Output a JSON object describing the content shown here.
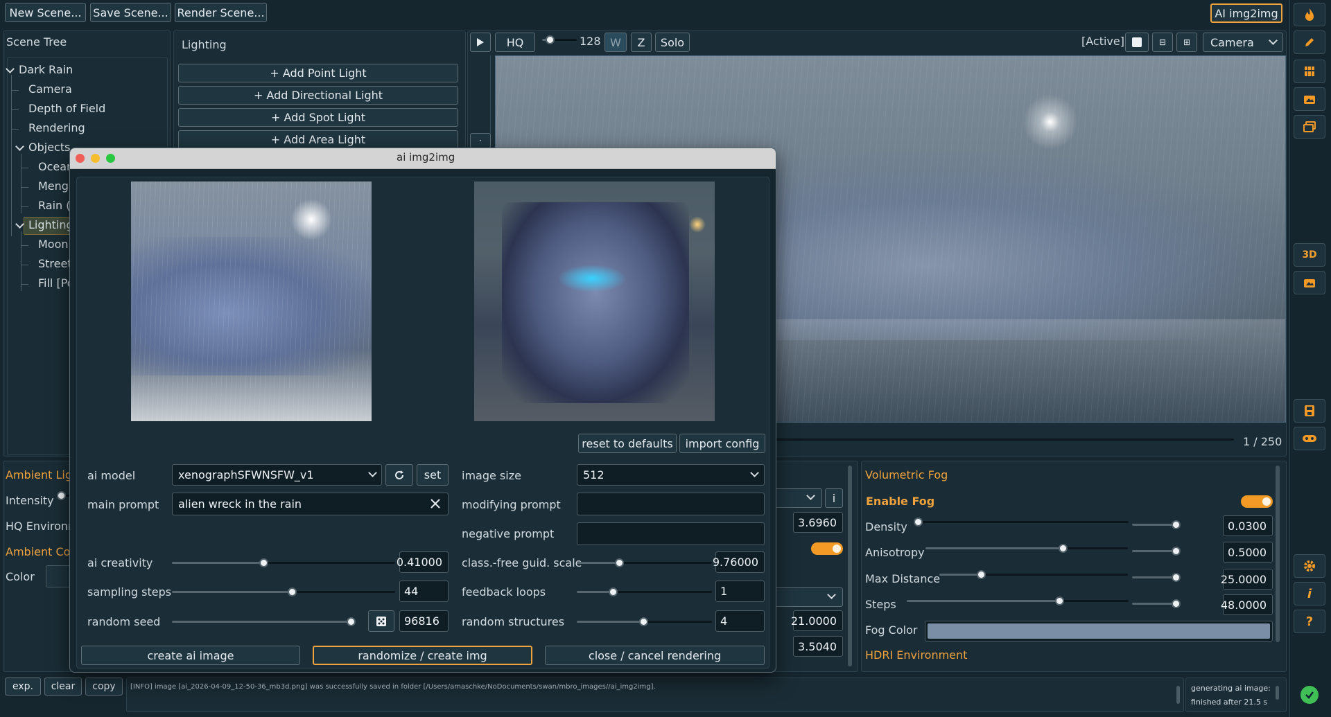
{
  "toolbar": {
    "new_scene": "New Scene...",
    "save_scene": "Save Scene...",
    "render_scene": "Render Scene...",
    "ai_img2img": "AI img2img"
  },
  "scene_tree": {
    "title": "Scene Tree",
    "items": [
      "Dark Rain",
      "Camera",
      "Depth of Field",
      "Rendering",
      "Objects",
      "Ocean",
      "Menge",
      "Rain (I",
      "Lighting",
      "Moon",
      "Street",
      "Fill [Po"
    ]
  },
  "lighting_panel": {
    "title": "Lighting",
    "buttons": [
      "+ Add Point Light",
      "+ Add Directional Light",
      "+ Add Spot Light",
      "+ Add Area Light"
    ]
  },
  "viewport": {
    "hq": "HQ",
    "samples": "128",
    "w": "W",
    "z": "Z",
    "solo": "Solo",
    "active": "[Active]",
    "camera_select": "Camera",
    "progress": "1 / 250",
    "progress_fraction": 0.004
  },
  "left_props": {
    "ambient_light": "Ambient Ligh",
    "intensity": "Intensity",
    "hq_environment": "HQ Environm",
    "ambient_color": "Ambient Colo",
    "color": "Color"
  },
  "mid_props": {
    "v1": "3.6960",
    "v2": "21.0000",
    "v3": "3.5040",
    "info": "i"
  },
  "fog": {
    "title": "Volumetric Fog",
    "enable": "Enable Fog",
    "density_label": "Density",
    "density": "0.0300",
    "anisotropy_label": "Anisotropy",
    "anisotropy": "0.5000",
    "max_distance_label": "Max Distance",
    "max_distance": "25.0000",
    "steps_label": "Steps",
    "steps": "48.0000",
    "fog_color_label": "Fog Color",
    "hdri": "HDRI Environment",
    "fog_color_hex": "#7a8fa6"
  },
  "dialog": {
    "title": "ai img2img",
    "reset": "reset to defaults",
    "import": "import config",
    "ai_model_label": "ai model",
    "ai_model": "xenographSFWNSFW_v1",
    "set": "set",
    "image_size_label": "image size",
    "image_size": "512",
    "main_prompt_label": "main prompt",
    "main_prompt": "alien wreck in the rain",
    "modifying_prompt_label": "modifying prompt",
    "modifying_prompt": "",
    "negative_prompt_label": "negative prompt",
    "negative_prompt": "",
    "ai_creativity_label": "ai creativity",
    "ai_creativity": "0.41000",
    "cfg_label": "class.-free guid. scale",
    "cfg": "9.76000",
    "sampling_steps_label": "sampling steps",
    "sampling_steps": "44",
    "feedback_loops_label": "feedback loops",
    "feedback_loops": "1",
    "random_seed_label": "random seed",
    "random_seed": "96816",
    "random_structures_label": "random structures",
    "random_structures": "4",
    "create": "create ai image",
    "randomize": "randomize / create img",
    "close": "close / cancel rendering"
  },
  "log": {
    "exp": "exp.",
    "clear": "clear",
    "copy": "copy",
    "message": "[INFO] image [ai_2026-04-09_12-50-36_mb3d.png] was successfully saved in folder [/Users/amaschke/NoDocuments/swan/mbro_images//ai_img2img].",
    "status_line1": "generating ai image:",
    "status_line2": "finished after 21.5 s"
  },
  "side_icons": [
    "flame-icon",
    "pencil-icon",
    "grid-icon",
    "folder-image-icon",
    "layers-icon",
    "3d-icon",
    "image-folder-icon",
    "save-icon",
    "gamepad-icon",
    "gear-icon",
    "info-icon",
    "help-icon",
    "check-icon"
  ],
  "side_labels": {
    "three_d": "3D",
    "info": "i",
    "help": "?"
  },
  "colors": {
    "accent": "#f0a23c",
    "ok": "#3fbf55"
  }
}
